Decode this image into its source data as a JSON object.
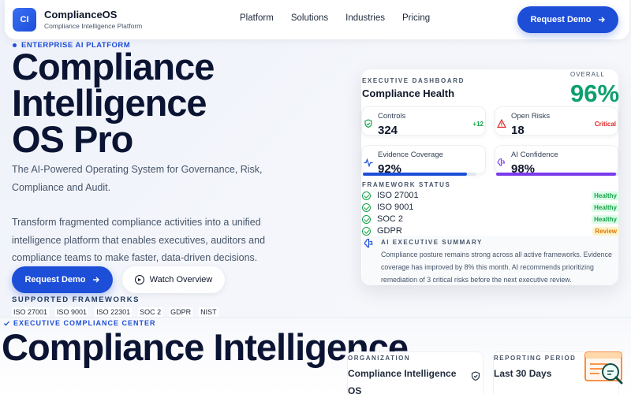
{
  "header": {
    "logo_text": "CI",
    "brand_name": "ComplianceOS",
    "brand_tagline": "Compliance Intelligence Platform",
    "nav": [
      "Platform",
      "Solutions",
      "Industries",
      "Pricing"
    ],
    "cta_label": "Request Demo"
  },
  "hero": {
    "kicker": "ENTERPRISE AI PLATFORM",
    "title_lines": [
      "Compliance",
      "Intelligence",
      "OS Pro"
    ],
    "description": "The AI-Powered Operating System for Governance, Risk, Compliance and Audit.",
    "description2": "Transform fragmented compliance activities into a unified intelligence platform that enables executives, auditors and compliance teams to make faster, data-driven decisions.",
    "primary_cta": "Request Demo",
    "secondary_cta": "Watch Overview",
    "frameworks_title": "SUPPORTED FRAMEWORKS",
    "frameworks": [
      "ISO 27001",
      "ISO 9001",
      "ISO 22301",
      "SOC 2",
      "GDPR",
      "NIST"
    ]
  },
  "dashboard": {
    "kicker": "EXECUTIVE DASHBOARD",
    "title": "Compliance Health",
    "overall_label": "OVERALL",
    "overall_value": "96%",
    "tiles": [
      {
        "label": "Controls",
        "value": "324",
        "tag": "+12",
        "tag_color": "#16a34a",
        "icon": "shield-check-icon"
      },
      {
        "label": "Open Risks",
        "value": "18",
        "tag": "Critical",
        "tag_color": "#dc2626",
        "icon": "warning-triangle-icon"
      },
      {
        "label": "Evidence Coverage",
        "value": "92%",
        "progress": 0.92,
        "bar_color": "#1d4ed8",
        "icon": "pulse-icon"
      },
      {
        "label": "AI Confidence",
        "value": "98%",
        "progress": 0.98,
        "bar_color": "#7c3aed",
        "icon": "brain-icon"
      }
    ],
    "framework_status_title": "FRAMEWORK STATUS",
    "framework_status": [
      {
        "name": "ISO 27001",
        "status": "Healthy",
        "color": "#16a34a",
        "bg": "#dcfce7"
      },
      {
        "name": "ISO 9001",
        "status": "Healthy",
        "color": "#16a34a",
        "bg": "#dcfce7"
      },
      {
        "name": "SOC 2",
        "status": "Healthy",
        "color": "#16a34a",
        "bg": "#dcfce7"
      },
      {
        "name": "GDPR",
        "status": "Review",
        "color": "#d97706",
        "bg": "#fef3c7"
      }
    ],
    "ai_summary_title": "AI EXECUTIVE SUMMARY",
    "ai_summary": "Compliance posture remains strong across all active frameworks. Evidence coverage has improved by 8% this month. AI recommends prioritizing remediation of 3 critical risks before the next executive review."
  },
  "lower": {
    "kicker": "EXECUTIVE COMPLIANCE CENTER",
    "title": "Compliance Intelligence",
    "organization_label": "ORGANIZATION",
    "organization_value": "Compliance Intelligence OS",
    "period_label": "REPORTING PERIOD",
    "period_value": "Last 30 Days"
  },
  "colors": {
    "accent": "#1d4ed8",
    "success": "#0d9f6e",
    "danger": "#dc2626",
    "purple": "#7c3aed"
  }
}
